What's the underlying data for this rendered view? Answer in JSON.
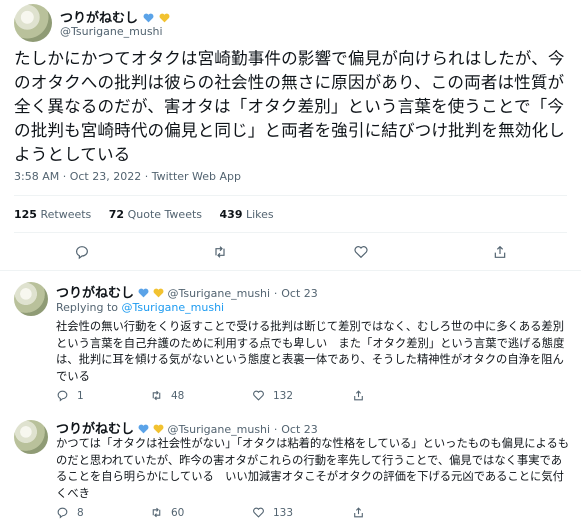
{
  "tweet": {
    "author_name": "つりがねむし",
    "author_handle": "@Tsurigane_mushi",
    "text": "たしかにかつてオタクは宮崎勤事件の影響で偏見が向けられはしたが、今のオタクへの批判は彼らの社会性の無さに原因があり、この両者は性質が全く異なるのだが、害オタは「オタク差別」という言葉を使うことで「今の批判も宮崎時代の偏見と同じ」と両者を強引に結びつけ批判を無効化しようとしている",
    "timestamp": "3:58 AM · Oct 23, 2022 · Twitter Web App",
    "retweets": "125",
    "retweets_label": "Retweets",
    "quote_tweets": "72",
    "quote_tweets_label": "Quote Tweets",
    "likes": "439",
    "likes_label": "Likes"
  },
  "replies": [
    {
      "author_name": "つりがねむし",
      "author_handle": "@Tsurigane_mushi",
      "date": "Oct 23",
      "replying_to_label": "Replying to",
      "replying_to_handle": "@Tsurigane_mushi",
      "text": "社会性の無い行動をくり返すことで受ける批判は断じて差別ではなく、むしろ世の中に多くある差別という言葉を自己弁護のために利用する点でも卑しい　また「オタク差別」という言葉で逃げる態度は、批判に耳を傾ける気がないという態度と表裏一体であり、そうした精神性がオタクの自浄を阻んでいる",
      "reply_count": "1",
      "retweet_count": "48",
      "like_count": "132"
    },
    {
      "author_name": "つりがねむし",
      "author_handle": "@Tsurigane_mushi",
      "date": "Oct 23",
      "text": "かつては「オタクは社会性がない」「オタクは粘着的な性格をしている」といったものも偏見によるものだと思われていたが、昨今の害オタがこれらの行動を率先して行うことで、偏見ではなく事実であることを自ら明らかにしている　いい加減害オタこそがオタクの評価を下げる元凶であることに気付くべき",
      "reply_count": "8",
      "retweet_count": "60",
      "like_count": "133"
    }
  ],
  "colors": {
    "heart_blue": "#5ba3e8",
    "heart_yellow": "#f2c230",
    "link": "#1d9bf0",
    "muted": "#536471"
  }
}
